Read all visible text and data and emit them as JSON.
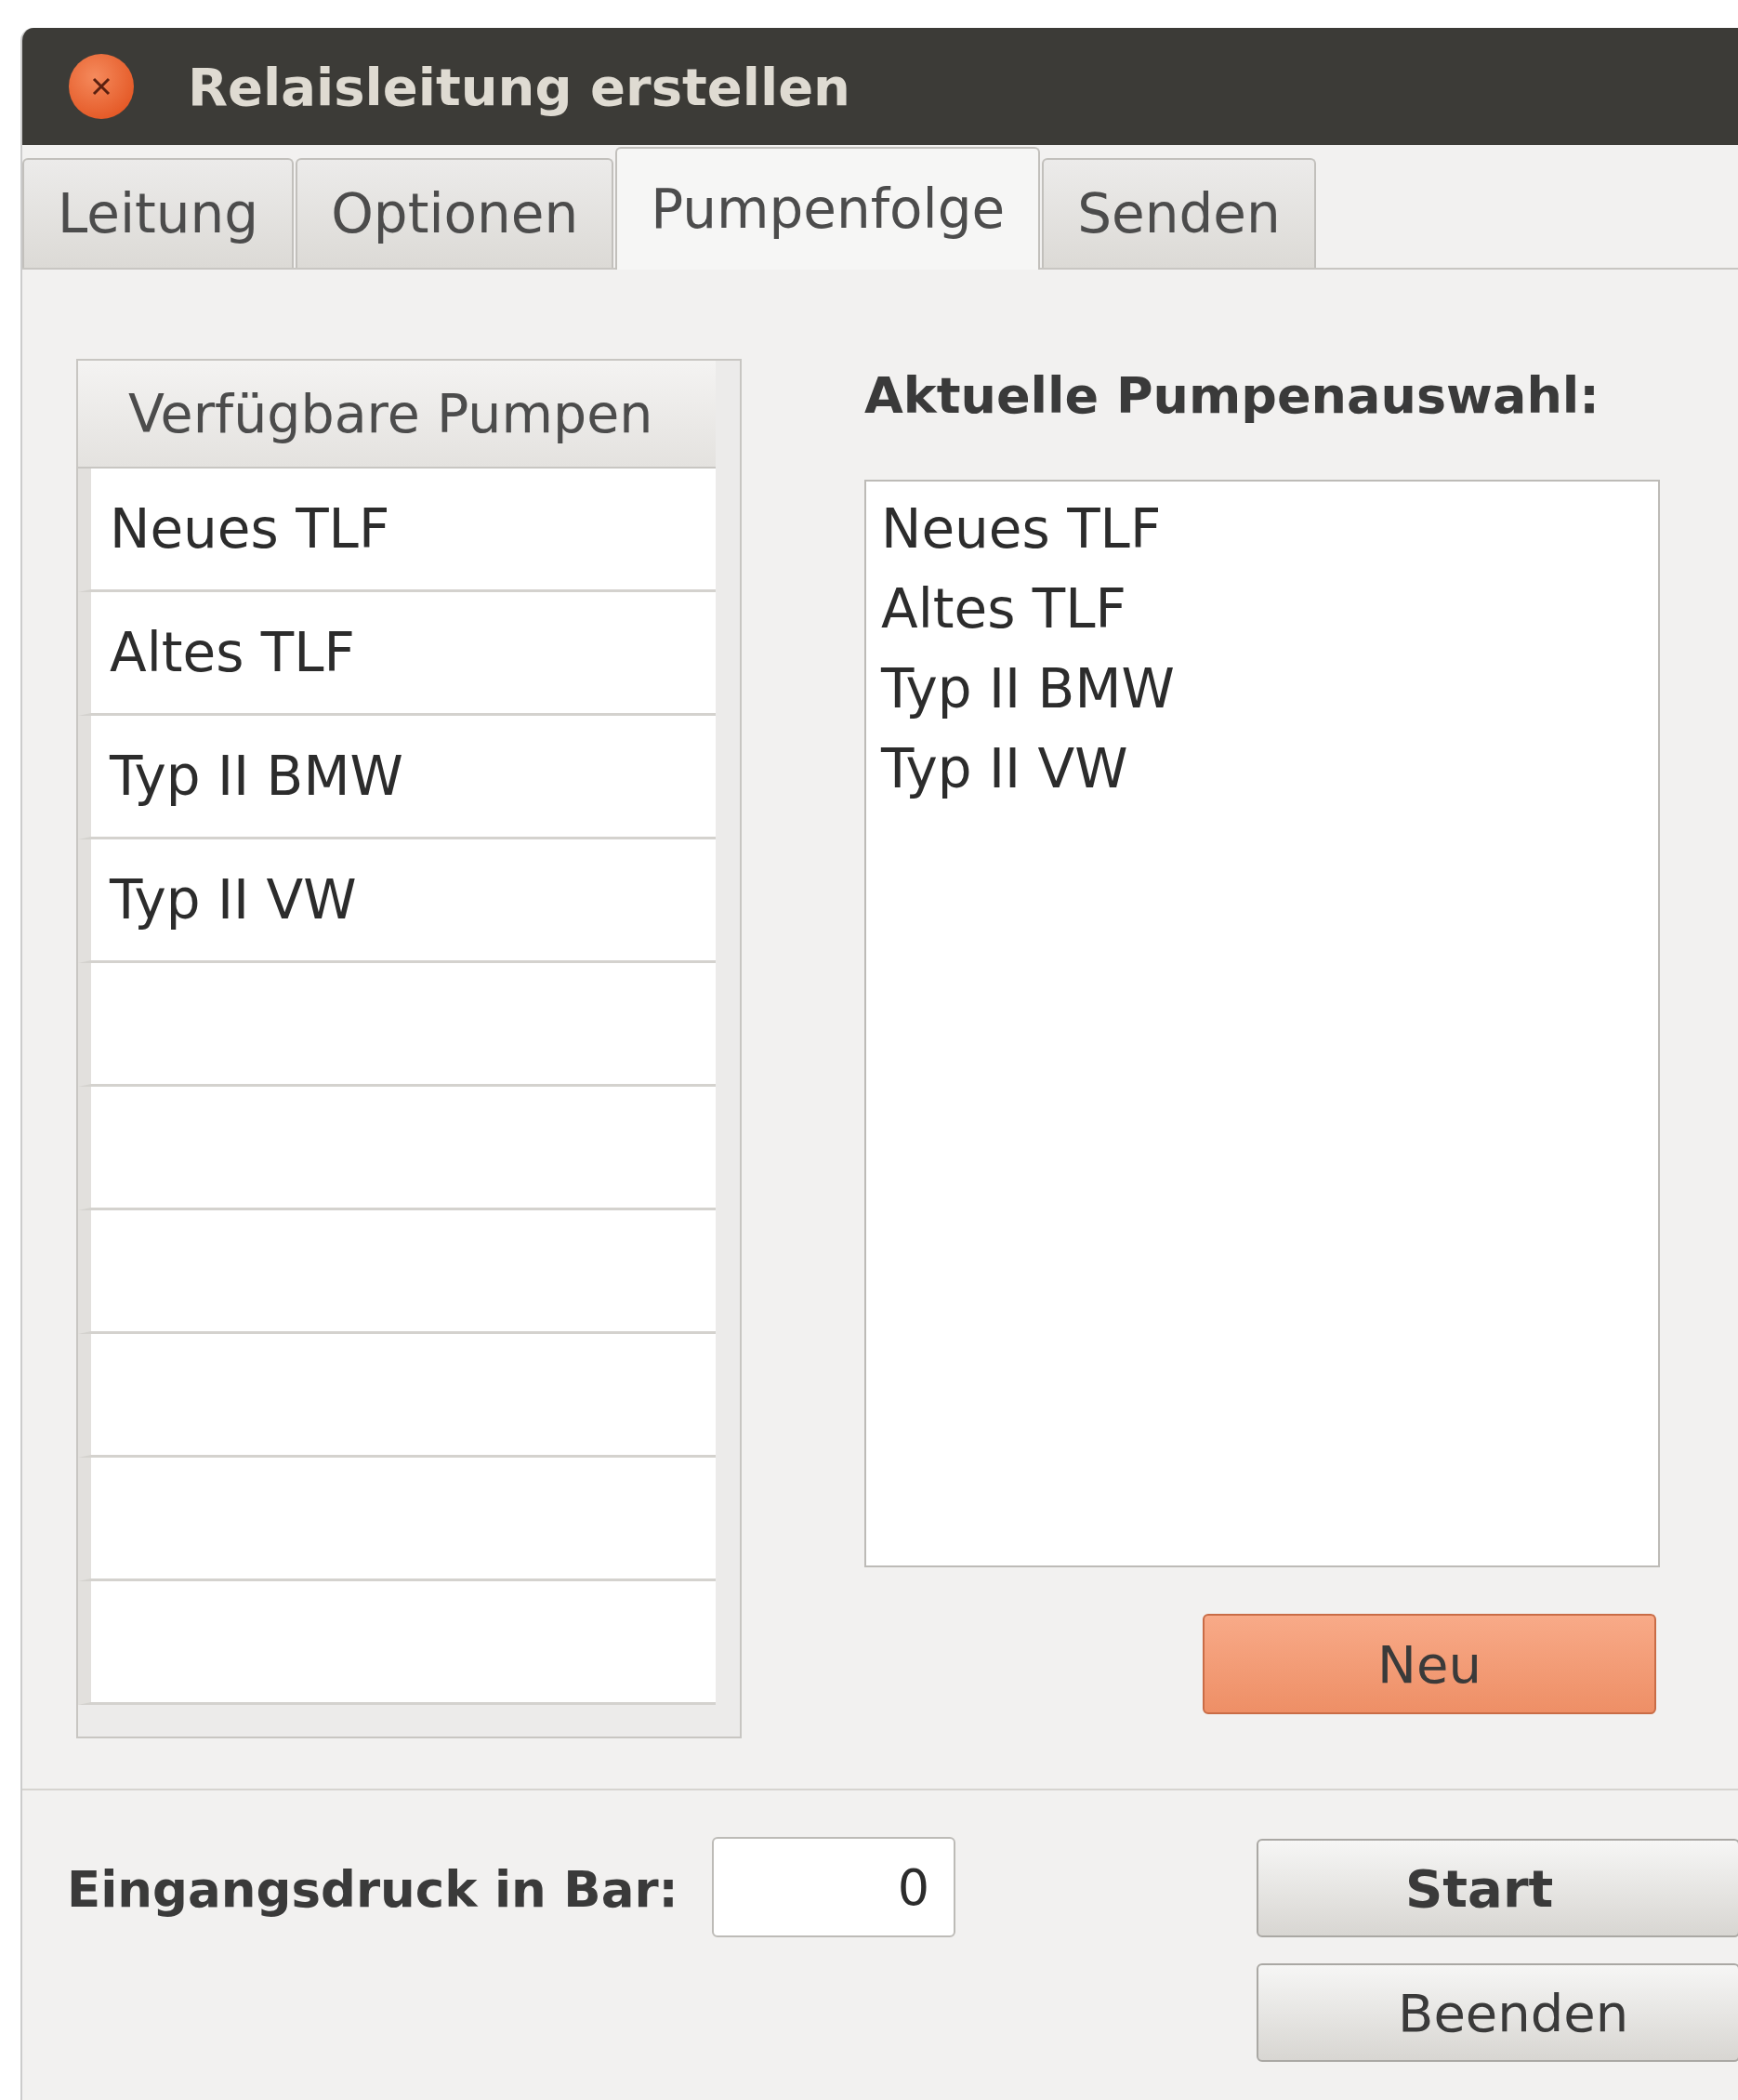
{
  "window": {
    "title": "Relaisleitung erstellen"
  },
  "tabs": [
    {
      "label": "Leitung",
      "selected": false
    },
    {
      "label": "Optionen",
      "selected": false
    },
    {
      "label": "Pumpenfolge",
      "selected": true
    },
    {
      "label": "Senden",
      "selected": false
    }
  ],
  "available_pumps": {
    "header": "Verfügbare Pumpen",
    "rows": [
      "Neues TLF",
      "Altes TLF",
      "Typ II BMW",
      "Typ II VW"
    ]
  },
  "current_selection": {
    "label": "Aktuelle Pumpenauswahl:",
    "items": [
      "Neues TLF",
      "Altes TLF",
      "Typ II BMW",
      "Typ II VW"
    ]
  },
  "new_button": "Neu",
  "pressure": {
    "label": "Eingangsdruck in Bar:",
    "value": "0"
  },
  "buttons": [
    "Start",
    "Beenden"
  ]
}
